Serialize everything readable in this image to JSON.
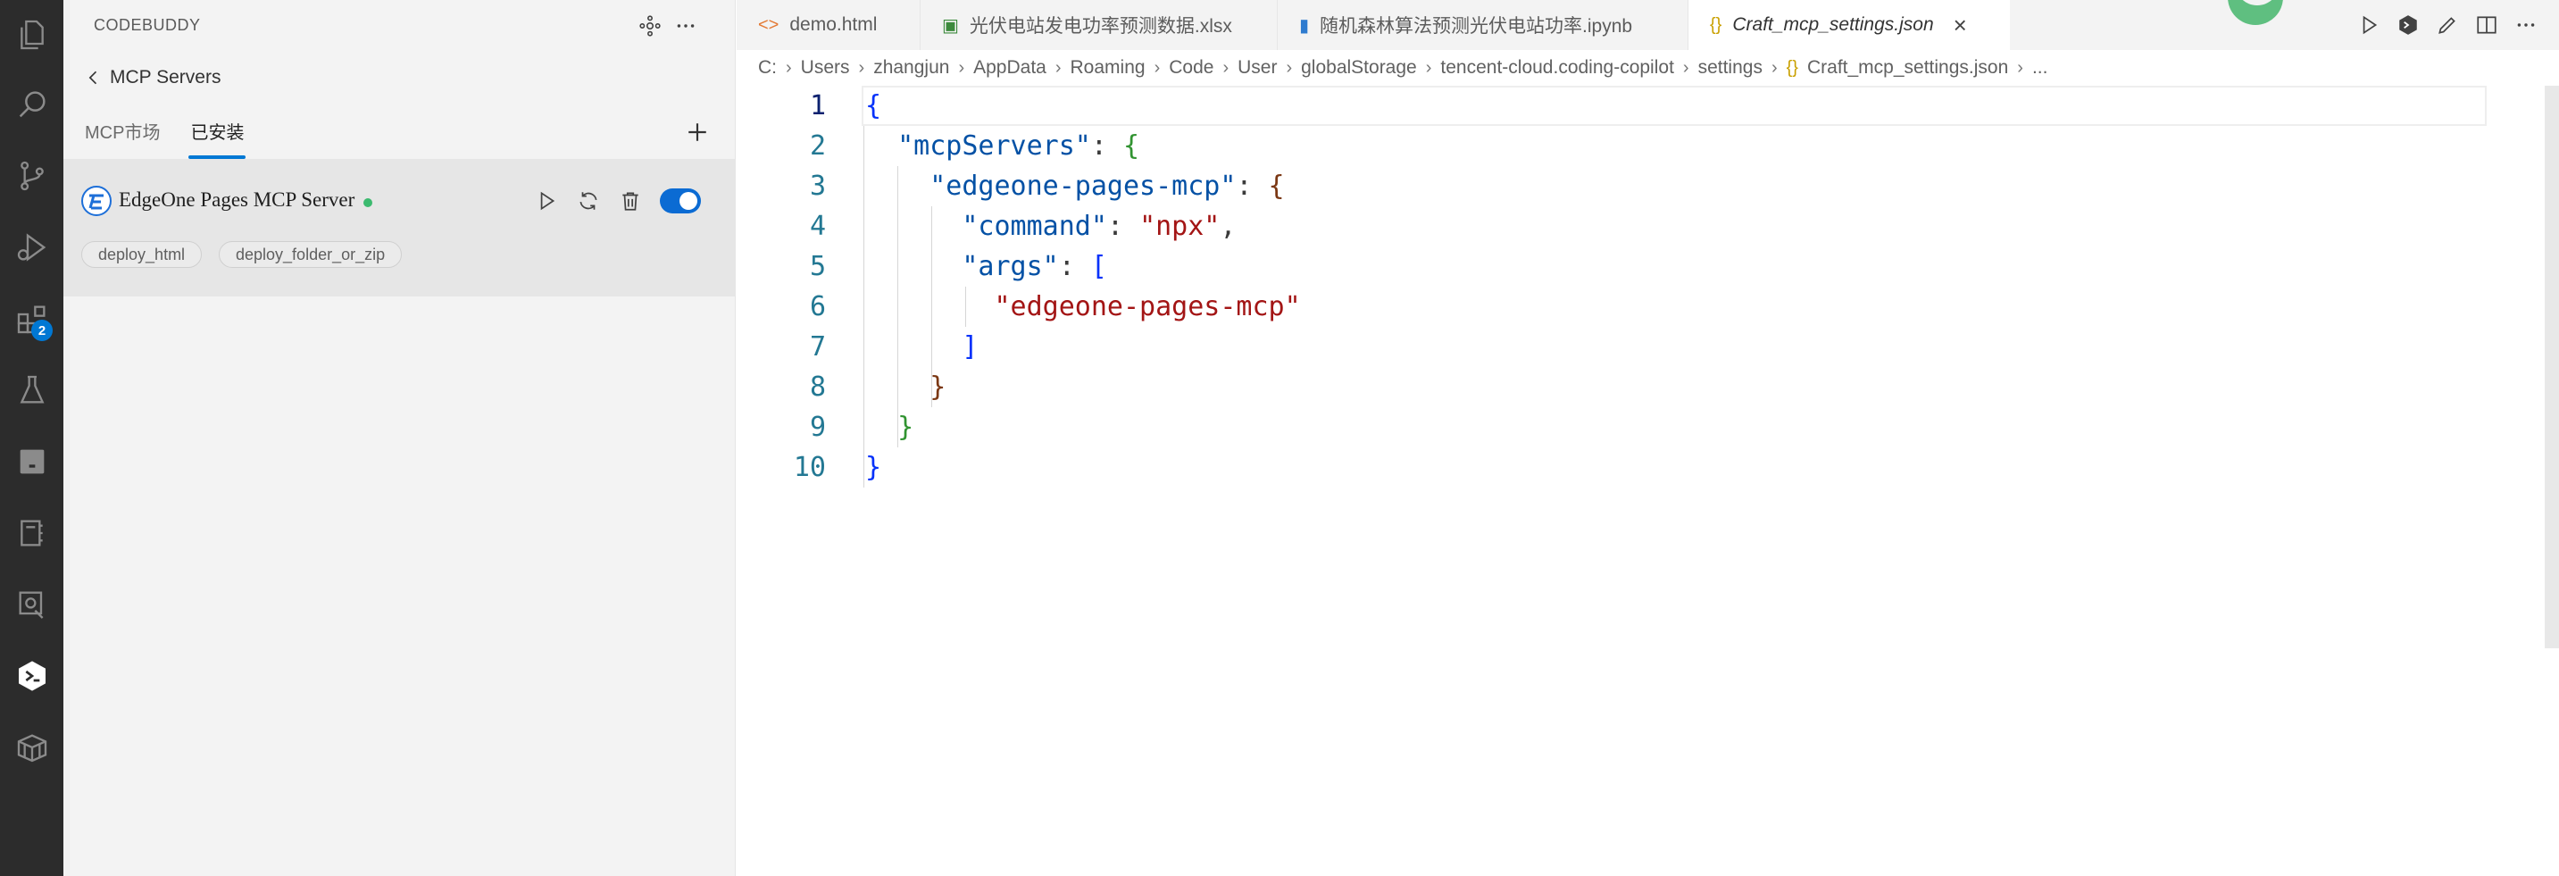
{
  "activity_bar": {
    "icons": [
      "explorer-icon",
      "search-icon",
      "source-control-icon",
      "run-debug-icon",
      "extensions-icon",
      "testing-icon",
      "panel-icon",
      "notebook-icon",
      "remote-icon",
      "codebuddy-icon",
      "packages-icon"
    ],
    "extensions_badge": "2"
  },
  "side_panel": {
    "title": "CODEBUDDY",
    "back_label": "MCP Servers",
    "tabs": [
      {
        "label": "MCP市场",
        "active": false
      },
      {
        "label": "已安装",
        "active": true
      }
    ],
    "server": {
      "name": "EdgeOne Pages MCP Server",
      "status_color": "#3cba6f",
      "enabled": true,
      "tools": [
        "deploy_html",
        "deploy_folder_or_zip"
      ]
    }
  },
  "editor": {
    "tabs": [
      {
        "label": "demo.html",
        "icon": "html-file-icon",
        "active": false
      },
      {
        "label": "光伏电站发电功率预测数据.xlsx",
        "icon": "excel-file-icon",
        "active": false
      },
      {
        "label": "随机森林算法预测光伏电站功率.ipynb",
        "icon": "notebook-file-icon",
        "active": false
      },
      {
        "label": "Craft_mcp_settings.json",
        "icon": "json-file-icon",
        "active": true
      }
    ],
    "breadcrumb": [
      "C:",
      "Users",
      "zhangjun",
      "AppData",
      "Roaming",
      "Code",
      "User",
      "globalStorage",
      "tencent-cloud.coding-copilot",
      "settings",
      "Craft_mcp_settings.json",
      "..."
    ],
    "line_numbers": [
      "1",
      "2",
      "3",
      "4",
      "5",
      "6",
      "7",
      "8",
      "9",
      "10"
    ],
    "code": {
      "l1": "{",
      "l2_key": "\"mcpServers\"",
      "l2_punct": ": ",
      "l2_brace": "{",
      "l3_key": "\"edgeone-pages-mcp\"",
      "l3_punct": ": ",
      "l3_brace": "{",
      "l4_key": "\"command\"",
      "l4_punct": ": ",
      "l4_val": "\"npx\"",
      "l4_comma": ",",
      "l5_key": "\"args\"",
      "l5_punct": ": ",
      "l5_bracket": "[",
      "l6_val": "\"edgeone-pages-mcp\"",
      "l7": "]",
      "l8": "}",
      "l9": "}",
      "l10": "}"
    }
  },
  "colors": {
    "accent": "#0078d4",
    "activity_bg": "#2c2c2c",
    "side_bg": "#f3f3f3"
  }
}
